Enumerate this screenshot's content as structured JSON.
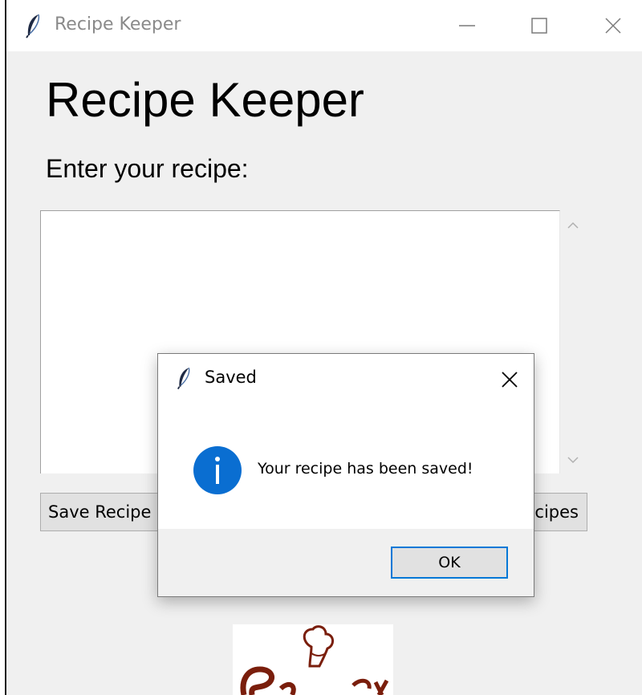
{
  "window": {
    "title": "Recipe Keeper",
    "controls": [
      "minimize",
      "maximize",
      "close"
    ]
  },
  "main": {
    "heading": "Recipe Keeper",
    "prompt": "Enter your recipe:",
    "recipe_text": "",
    "buttons": {
      "save_label": "Save Recipe",
      "view_label_visible": "cipes"
    }
  },
  "dialog": {
    "title": "Saved",
    "message": "Your recipe has been saved!",
    "ok_label": "OK",
    "icon": "info-icon"
  },
  "colors": {
    "accent": "#0078d7",
    "info_icon": "#0a6ed1",
    "logo": "#7a1e0c"
  },
  "icons": {
    "app": "feather-icon",
    "scroll_up": "chevron-up-icon",
    "scroll_down": "chevron-down-icon"
  }
}
